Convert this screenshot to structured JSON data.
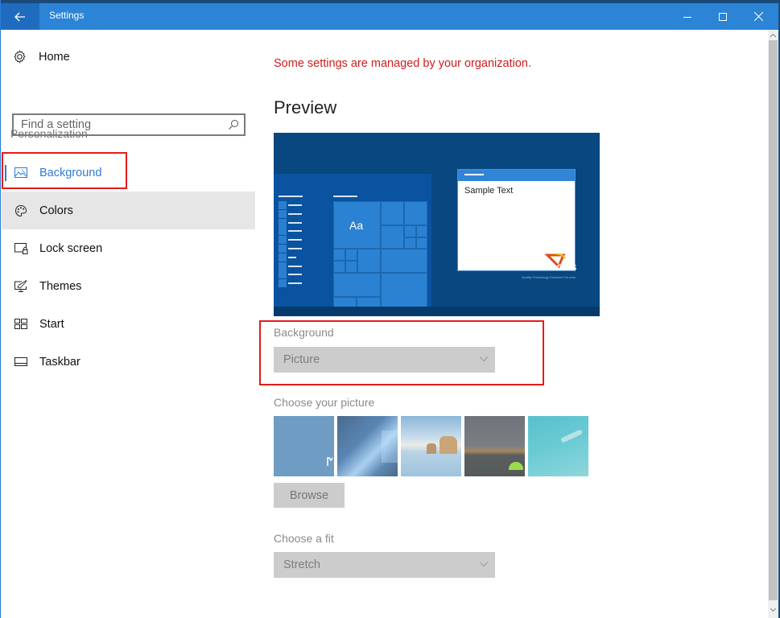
{
  "window": {
    "title": "Settings",
    "controls": {
      "minimize": "minimize",
      "maximize": "maximize",
      "close": "close"
    }
  },
  "sidebar": {
    "home_label": "Home",
    "search_placeholder": "Find a setting",
    "section_label": "Personalization",
    "items": [
      {
        "label": "Background",
        "icon": "picture-icon",
        "state": "selected"
      },
      {
        "label": "Colors",
        "icon": "palette-icon",
        "state": "hover"
      },
      {
        "label": "Lock screen",
        "icon": "lock-screen-icon",
        "state": "normal"
      },
      {
        "label": "Themes",
        "icon": "themes-icon",
        "state": "normal"
      },
      {
        "label": "Start",
        "icon": "start-icon",
        "state": "normal"
      },
      {
        "label": "Taskbar",
        "icon": "taskbar-icon",
        "state": "normal"
      }
    ]
  },
  "main": {
    "managed_notice": "Some settings are managed by your organization.",
    "preview_heading": "Preview",
    "preview": {
      "tile_label": "Aa",
      "sample_text": "Sample Text",
      "logo_text": "SOLUTIONS",
      "logo_tagline": "Quality Technology Delivered On-time"
    },
    "background_label": "Background",
    "background_value": "Picture",
    "choose_picture_label": "Choose your picture",
    "pictures": [
      {
        "name": "logo-wallpaper"
      },
      {
        "name": "windows-light"
      },
      {
        "name": "beach-rocks"
      },
      {
        "name": "night-sky-tent"
      },
      {
        "name": "underwater-swimmer"
      }
    ],
    "browse_label": "Browse",
    "fit_label": "Choose a fit",
    "fit_value": "Stretch"
  },
  "colors": {
    "accent": "#2b84d6",
    "managed_text": "#d01c1c",
    "annotation_box": "#e51a1a",
    "disabled_control": "#cccccc"
  }
}
